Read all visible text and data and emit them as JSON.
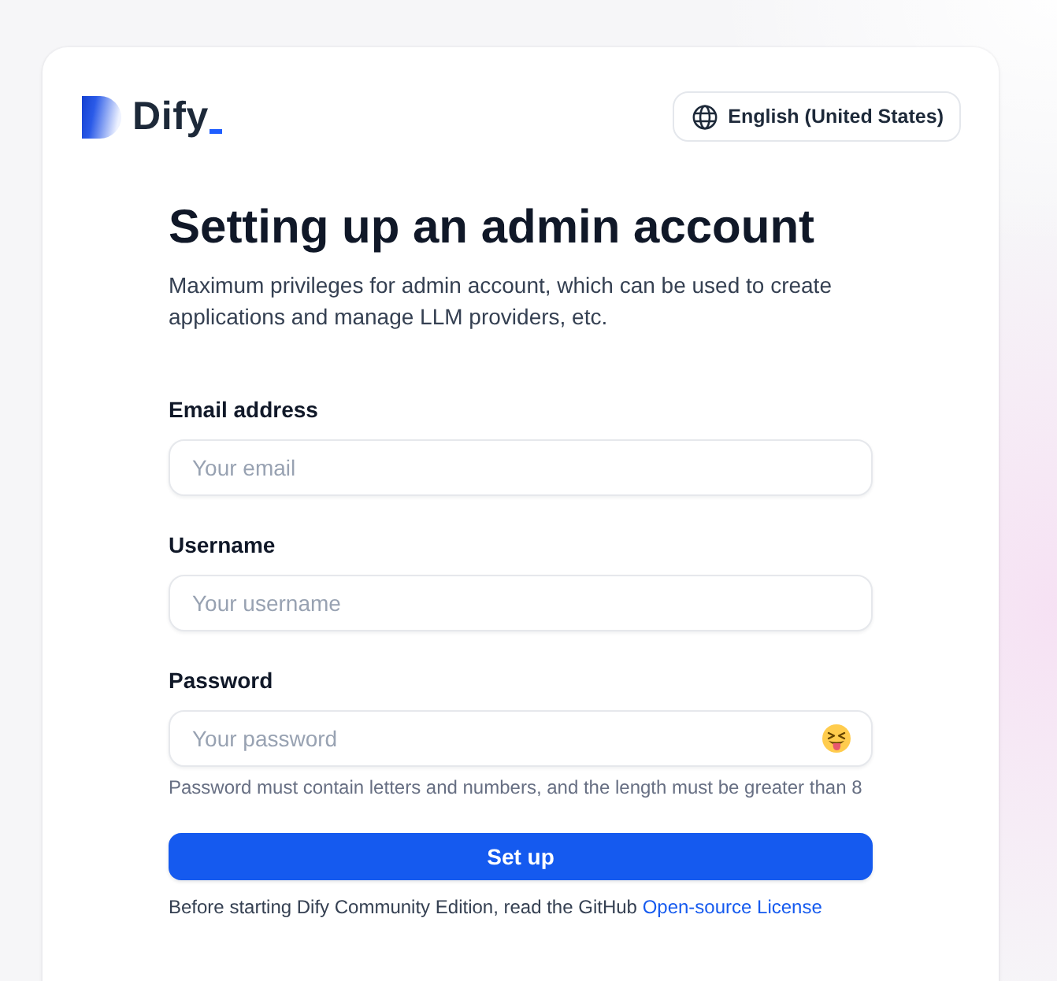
{
  "header": {
    "logo": {
      "text": "Dify"
    },
    "language_button": {
      "label": "English (United States)"
    }
  },
  "title": "Setting up an admin account",
  "subtitle": "Maximum privileges for admin account, which can be used to create applications and manage LLM providers, etc.",
  "fields": [
    {
      "kind": "email",
      "label": "Email address",
      "placeholder": "Your email"
    },
    {
      "kind": "text",
      "label": "Username",
      "placeholder": "Your username"
    },
    {
      "kind": "password",
      "label": "Password",
      "placeholder": "Your password",
      "hint": "Password must contain letters and numbers, and the length must be greater than 8"
    }
  ],
  "submit_button": {
    "label": "Set up"
  },
  "footer": {
    "text": "Before starting Dify Community Edition, read the GitHub",
    "link": "Open-source License"
  }
}
